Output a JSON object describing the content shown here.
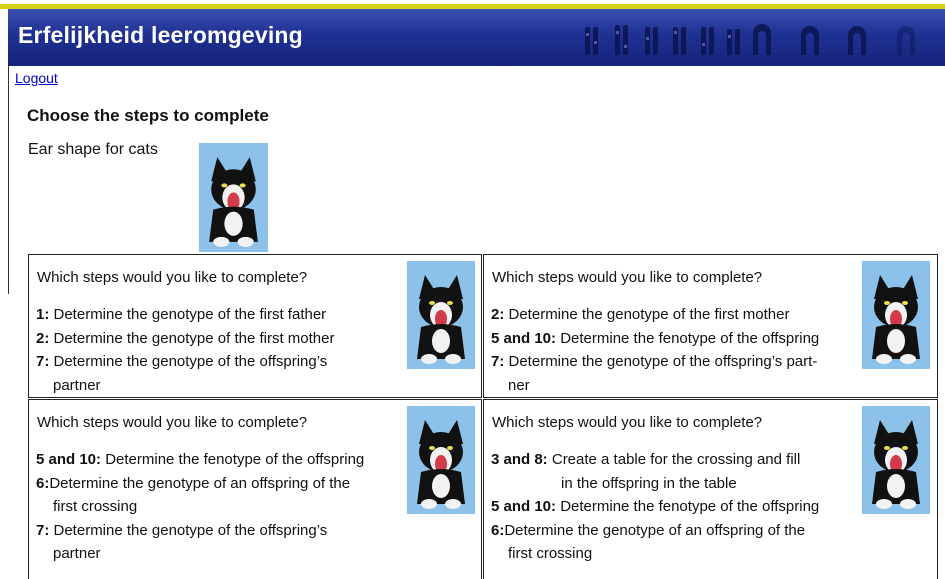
{
  "app": {
    "title": "Erfelijkheid leeromgeving",
    "accent_color": "#1f3192",
    "stripe_color": "#d8d21a"
  },
  "nav": {
    "logout_label": "Logout"
  },
  "main": {
    "heading": "Choose the steps to complete",
    "subject": "Ear shape for cats",
    "subject_image_icon": "cat-photo-icon"
  },
  "panels": [
    {
      "question": "Which steps would you like to complete?",
      "steps": [
        {
          "num": "1:",
          "text": " Determine the genotype of the first father",
          "cont": ""
        },
        {
          "num": "2:",
          "text": " Determine the genotype of the first mother",
          "cont": ""
        },
        {
          "num": "7:",
          "text": " Determine the genotype of the offspring’s",
          "cont": "partner"
        }
      ]
    },
    {
      "question": "Which steps would you like to complete?",
      "steps": [
        {
          "num": "2:",
          "text": " Determine the genotype of the first mother",
          "cont": ""
        },
        {
          "num": "5 and 10:",
          "text": " Determine the fenotype of the offspring",
          "cont": ""
        },
        {
          "num": "7:",
          "text": " Determine the genotype of the offspring’s part-",
          "cont": "ner"
        }
      ]
    },
    {
      "question": "Which steps would you like to complete?",
      "steps": [
        {
          "num": "5 and 10:",
          "text": " Determine the fenotype of the offspring",
          "cont": ""
        },
        {
          "num": "6:",
          "text": "Determine the genotype of an offspring of the",
          "cont": "first crossing"
        },
        {
          "num": "7:",
          "text": " Determine the genotype of the offspring’s",
          "cont": "partner"
        }
      ]
    },
    {
      "question": "Which steps would you like to complete?",
      "steps": [
        {
          "num": "3 and 8:",
          "text": " Create a table for the crossing and fill",
          "cont": "in the offspring in the table"
        },
        {
          "num": "5 and 10:",
          "text": " Determine the fenotype of the offspring",
          "cont": ""
        },
        {
          "num": "6:",
          "text": "Determine the genotype of an offspring of the",
          "cont": "first crossing"
        }
      ]
    }
  ]
}
